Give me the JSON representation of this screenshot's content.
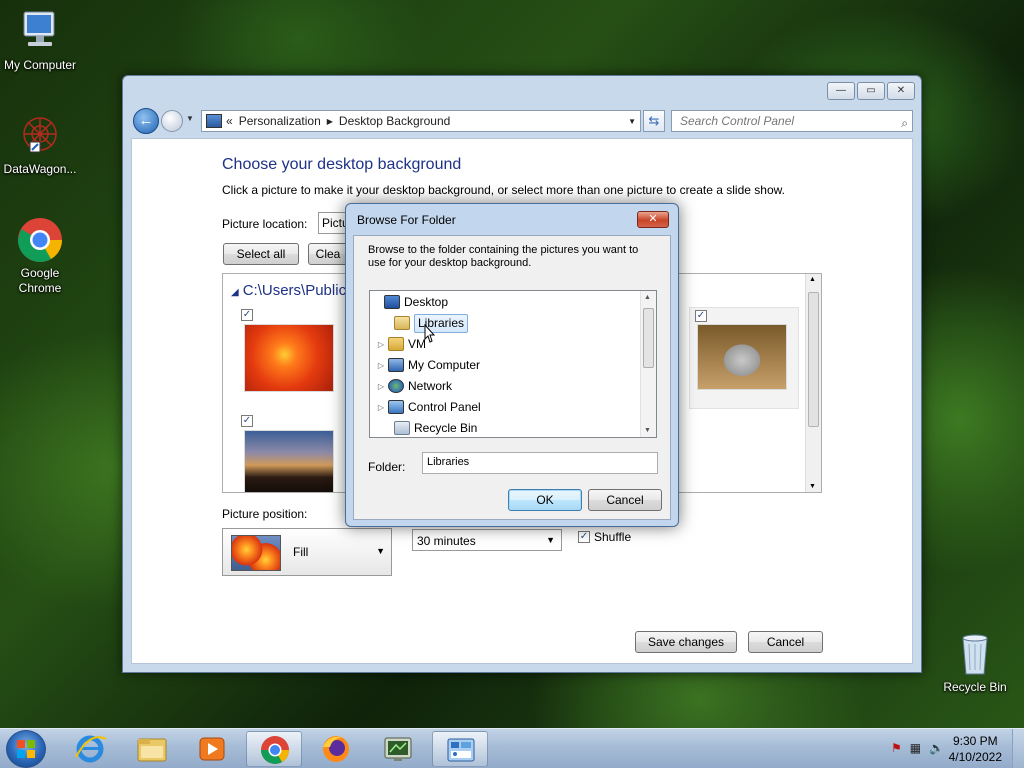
{
  "desktop": {
    "icons": [
      {
        "label": "My Computer"
      },
      {
        "label": "DataWagon..."
      },
      {
        "label": "Google Chrome"
      },
      {
        "label": "Recycle Bin"
      }
    ]
  },
  "window": {
    "address": {
      "part1": "Personalization",
      "part2": "Desktop Background"
    },
    "search_placeholder": "Search Control Panel",
    "heading": "Choose your desktop background",
    "description": "Click a picture to make it your desktop background, or select more than one picture to create a slide show.",
    "picture_location_label": "Picture location:",
    "picture_location_value": "Pictu",
    "select_all": "Select all",
    "clear_all": "Clea",
    "gallery_path": "C:\\Users\\Public\\",
    "picture_position_label": "Picture position:",
    "picture_position_value": "Fill",
    "interval_value": "30 minutes",
    "shuffle_label": "Shuffle",
    "save_changes": "Save changes",
    "cancel": "Cancel",
    "checkmark": "✓"
  },
  "dialog": {
    "title": "Browse For Folder",
    "instruction": "Browse to the folder containing the pictures you want to use for your desktop background.",
    "tree": [
      {
        "label": "Desktop"
      },
      {
        "label": "Libraries"
      },
      {
        "label": "VM"
      },
      {
        "label": "My Computer"
      },
      {
        "label": "Network"
      },
      {
        "label": "Control Panel"
      },
      {
        "label": "Recycle Bin"
      }
    ],
    "folder_label": "Folder:",
    "folder_value": "Libraries",
    "ok": "OK",
    "cancel": "Cancel"
  },
  "taskbar": {
    "time": "9:30 PM",
    "date": "4/10/2022"
  }
}
